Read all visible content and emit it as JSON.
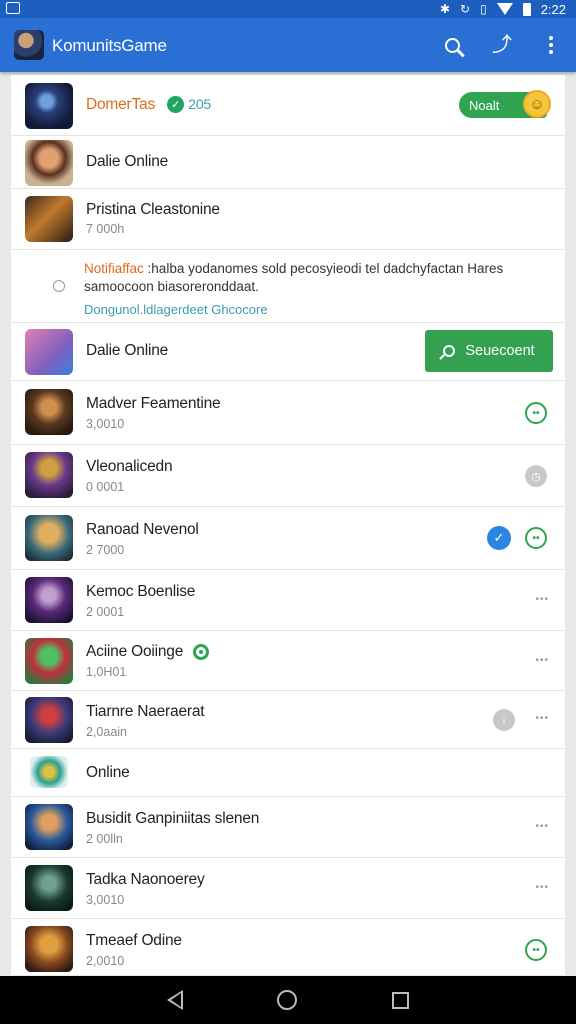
{
  "status_bar": {
    "time": "2:22"
  },
  "app_bar": {
    "title": "KomunitsGame"
  },
  "header_card": {
    "name": "DomerTas",
    "count": "205",
    "button_label": "Noalt"
  },
  "rows_top": [
    {
      "name": "Dalie Online",
      "sub": ""
    },
    {
      "name": "Pristina Cleastonine",
      "sub": "7 000h"
    }
  ],
  "notification": {
    "highlight": "Notifiaffac",
    "text": ":halba yodanomes sold pecosyieodi tel dadchyfactan Hares samoocoon biasoreronddaat.",
    "link": "Dongunol.ldlagerdeet Ghcocore"
  },
  "search_row": {
    "name": "Dalie Online",
    "button_label": "Seuecoent"
  },
  "items": [
    {
      "name": "Madver Feamentine",
      "sub": "3,0010"
    },
    {
      "name": "Vleonalicedn",
      "sub": "0 0001"
    },
    {
      "name": "Ranoad Nevenol",
      "sub": "2 7000"
    },
    {
      "name": "Kemoc Boenlise",
      "sub": "2 0001"
    },
    {
      "name": "Aciine Ooiinge",
      "sub": "1,0H01"
    },
    {
      "name": "Tiarnre Naeraerat",
      "sub": "2,0aain"
    },
    {
      "name": "Online",
      "sub": ""
    },
    {
      "name": "Busidit Ganpiniitas slenen",
      "sub": "2 00lln"
    },
    {
      "name": "Tadka Naonoerey",
      "sub": "3,0010"
    },
    {
      "name": "Tmeaef Odine",
      "sub": "2,0010"
    }
  ],
  "icons": {
    "status_left": "sim-icon",
    "search": "search-icon",
    "share": "share-icon",
    "more": "more-vert-icon"
  },
  "colors": {
    "app_bar": "#2a6fd4",
    "status_bar": "#1d5fbf",
    "accent_green": "#34a151",
    "accent_blue": "#2a86e0",
    "highlight_orange": "#e06a1a"
  }
}
